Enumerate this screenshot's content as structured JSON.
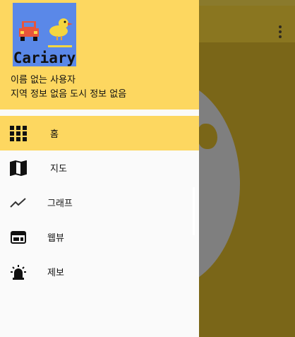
{
  "app": {
    "logo_text": "Cariary"
  },
  "drawer": {
    "user_name": "이름 없는 사용자",
    "user_location": "지역 정보 없음 도시 정보 없음",
    "menu": [
      {
        "label": "홈",
        "icon": "grid-icon",
        "active": true
      },
      {
        "label": "지도",
        "icon": "map-icon",
        "active": false
      },
      {
        "label": "그래프",
        "icon": "trending-icon",
        "active": false
      },
      {
        "label": "웹뷰",
        "icon": "webview-icon",
        "active": false
      },
      {
        "label": "제보",
        "icon": "siren-icon",
        "active": false
      }
    ]
  },
  "colors": {
    "header": "#fdd760",
    "active_item": "#fdd760",
    "drawer_bg": "#fafafa",
    "scrim": "#7a6618"
  }
}
